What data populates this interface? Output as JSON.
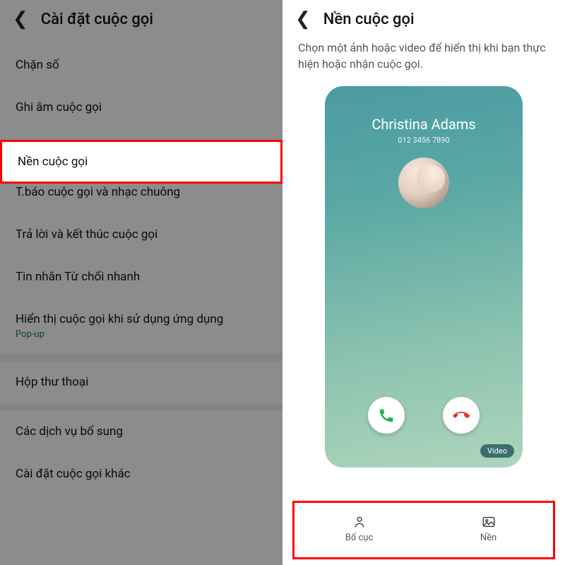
{
  "left": {
    "title": "Cài đặt cuộc gọi",
    "items": [
      {
        "label": "Chặn số"
      },
      {
        "label": "Ghi âm cuộc gọi"
      },
      {
        "label": "Nền cuộc gọi",
        "highlighted": true
      },
      {
        "label": "T.báo cuộc gọi và nhạc chuông"
      },
      {
        "label": "Trả lời và kết thúc cuộc gọi"
      },
      {
        "label": "Tin nhắn Từ chối nhanh"
      },
      {
        "label": "Hiển thị cuộc gọi khi sử dụng ứng dụng",
        "sub": "Pop-up"
      },
      {
        "label": "Hộp thư thoại"
      },
      {
        "label": "Các dịch vụ bổ sung"
      },
      {
        "label": "Cài đặt cuộc gọi khác"
      }
    ]
  },
  "right": {
    "title": "Nền cuộc gọi",
    "description": "Chọn một ảnh hoặc video để hiển thị khi bạn thực hiện hoặc nhận cuộc gọi.",
    "preview": {
      "caller_name": "Christina Adams",
      "caller_number": "012 3456 7890",
      "video_badge": "Video"
    },
    "bottom": {
      "layout_label": "Bố cục",
      "background_label": "Nền"
    }
  }
}
